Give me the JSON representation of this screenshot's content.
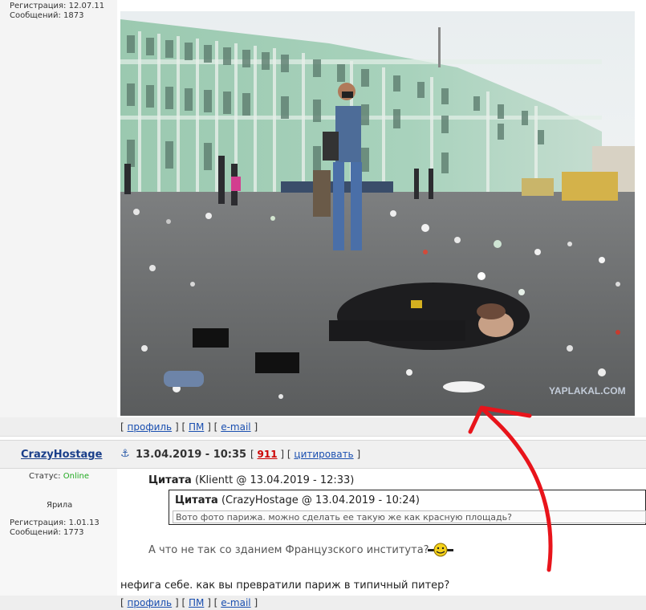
{
  "post1": {
    "registration": "Регистрация: 12.07.11",
    "messages": "Сообщений: 1873",
    "watermark": "YAPLAKAL.COM",
    "links": {
      "open": "[",
      "profile": "профиль",
      "sep1": "] [",
      "pm": "ПМ",
      "sep2": "] [",
      "email": "e-mail",
      "close": "]"
    }
  },
  "post2": {
    "username": "CrazyHostage",
    "date": "13.04.2019 - 10:35",
    "count_open": "[",
    "count": "911",
    "count_sep": "] [",
    "quote_link": "цитировать",
    "count_close": "]",
    "status_label": "Статус:",
    "status_value": "Online",
    "rank": "Ярила",
    "registration": "Регистрация: 1.01.13",
    "messages": "Сообщений: 1773",
    "quote_outer_label": "Цитата",
    "quote_outer_meta": "(Klientt @ 13.04.2019 - 12:33)",
    "quote_inner_label": "Цитата",
    "quote_inner_meta": "(CrazyHostage @ 13.04.2019 - 10:24)",
    "quote_inner_text": "Вото фото парижа. можно сделать ее такую же как красную площадь?",
    "quote_reply": "А что не так со зданием Французского института?",
    "body": "нефига себе. как вы превратили париж в типичный питер?",
    "links": {
      "open": "[",
      "profile": "профиль",
      "sep1": "] [",
      "pm": "ПМ",
      "sep2": "] [",
      "email": "e-mail",
      "close": "]"
    }
  },
  "icons": {
    "anchor": "anchor-icon",
    "smiley": "smiley-icon",
    "arrow": "red-arrow"
  },
  "colors": {
    "username": "#1a3f8a",
    "online": "#22aa22",
    "count": "#cc0000",
    "link": "#1a4fb0",
    "arrow": "#e8141b"
  }
}
